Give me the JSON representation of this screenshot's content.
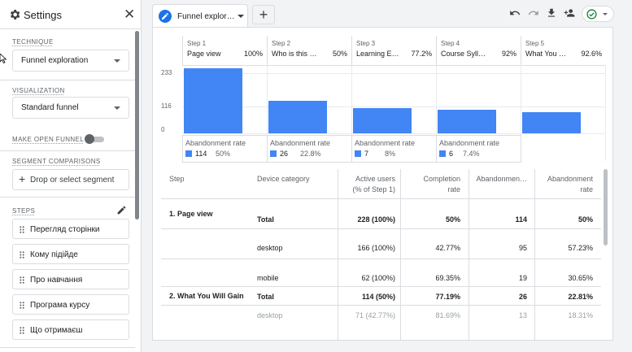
{
  "sidebar": {
    "title": "Settings",
    "technique": {
      "label": "TECHNIQUE",
      "value": "Funnel exploration"
    },
    "visualization": {
      "label": "VISUALIZATION",
      "value": "Standard funnel"
    },
    "open_funnel": {
      "label": "MAKE OPEN FUNNEL",
      "enabled": false
    },
    "segments": {
      "label": "SEGMENT COMPARISONS",
      "button": "Drop or select segment"
    },
    "steps": {
      "label": "STEPS",
      "items": [
        "Перегляд сторінки",
        "Кому підійде",
        "Про навчання",
        "Програма курсу",
        "Що отримаєш"
      ]
    }
  },
  "tabs": [
    {
      "label": "Funnel explor…"
    }
  ],
  "toolbar": {
    "icons": [
      "undo-icon",
      "redo-icon",
      "download-icon",
      "share-user-icon",
      "check-circle-icon"
    ],
    "status_color": "#188038"
  },
  "funnel": {
    "steps": [
      {
        "num": "Step 1",
        "name": "Page view",
        "pct": "100%",
        "aband_count": "114",
        "aband_pct": "50%"
      },
      {
        "num": "Step 2",
        "name": "Who is this …",
        "pct": "50%",
        "aband_count": "26",
        "aband_pct": "22.8%"
      },
      {
        "num": "Step 3",
        "name": "Learning E…",
        "pct": "77.2%",
        "aband_count": "7",
        "aband_pct": "8%"
      },
      {
        "num": "Step 4",
        "name": "Course Syll…",
        "pct": "92%",
        "aband_count": "6",
        "aband_pct": "7.4%"
      },
      {
        "num": "Step 5",
        "name": "What You …",
        "pct": "92.6%",
        "aband_count": "",
        "aband_pct": ""
      }
    ],
    "abandonment_label": "Abandonment rate",
    "bar_color": "#4285f4"
  },
  "chart_data": {
    "type": "bar",
    "categories": [
      "Step 1",
      "Step 2",
      "Step 3",
      "Step 4",
      "Step 5"
    ],
    "values": [
      228,
      114,
      88,
      81,
      75
    ],
    "y_ticks": [
      "233",
      "116",
      "0"
    ],
    "ylim": [
      0,
      233
    ],
    "grid": true
  },
  "table": {
    "headers": {
      "step": "Step",
      "device": "Device category",
      "active_users": [
        "Active users",
        "(% of Step 1)"
      ],
      "completion": [
        "Completion",
        "rate"
      ],
      "abandonments": "Abandonmen…",
      "abandon_rate": [
        "Abandonment",
        "rate"
      ]
    },
    "rows": [
      {
        "step": "1. Page view",
        "device": "Total",
        "active": "228 (100%)",
        "completion": "50%",
        "abandon": "114",
        "rate": "50%",
        "bold": true
      },
      {
        "step": "",
        "device": "desktop",
        "active": "166 (100%)",
        "completion": "42.77%",
        "abandon": "95",
        "rate": "57.23%",
        "bold": false
      },
      {
        "step": "",
        "device": "mobile",
        "active": "62 (100%)",
        "completion": "69.35%",
        "abandon": "19",
        "rate": "30.65%",
        "bold": false
      },
      {
        "step": "2. What You Will Gain",
        "device": "Total",
        "active": "114 (50%)",
        "completion": "77.19%",
        "abandon": "26",
        "rate": "22.81%",
        "bold": true
      },
      {
        "step": "",
        "device": "desktop",
        "active": "71 (42.77%)",
        "completion": "81.69%",
        "abandon": "13",
        "rate": "18.31%",
        "bold": false
      }
    ]
  }
}
